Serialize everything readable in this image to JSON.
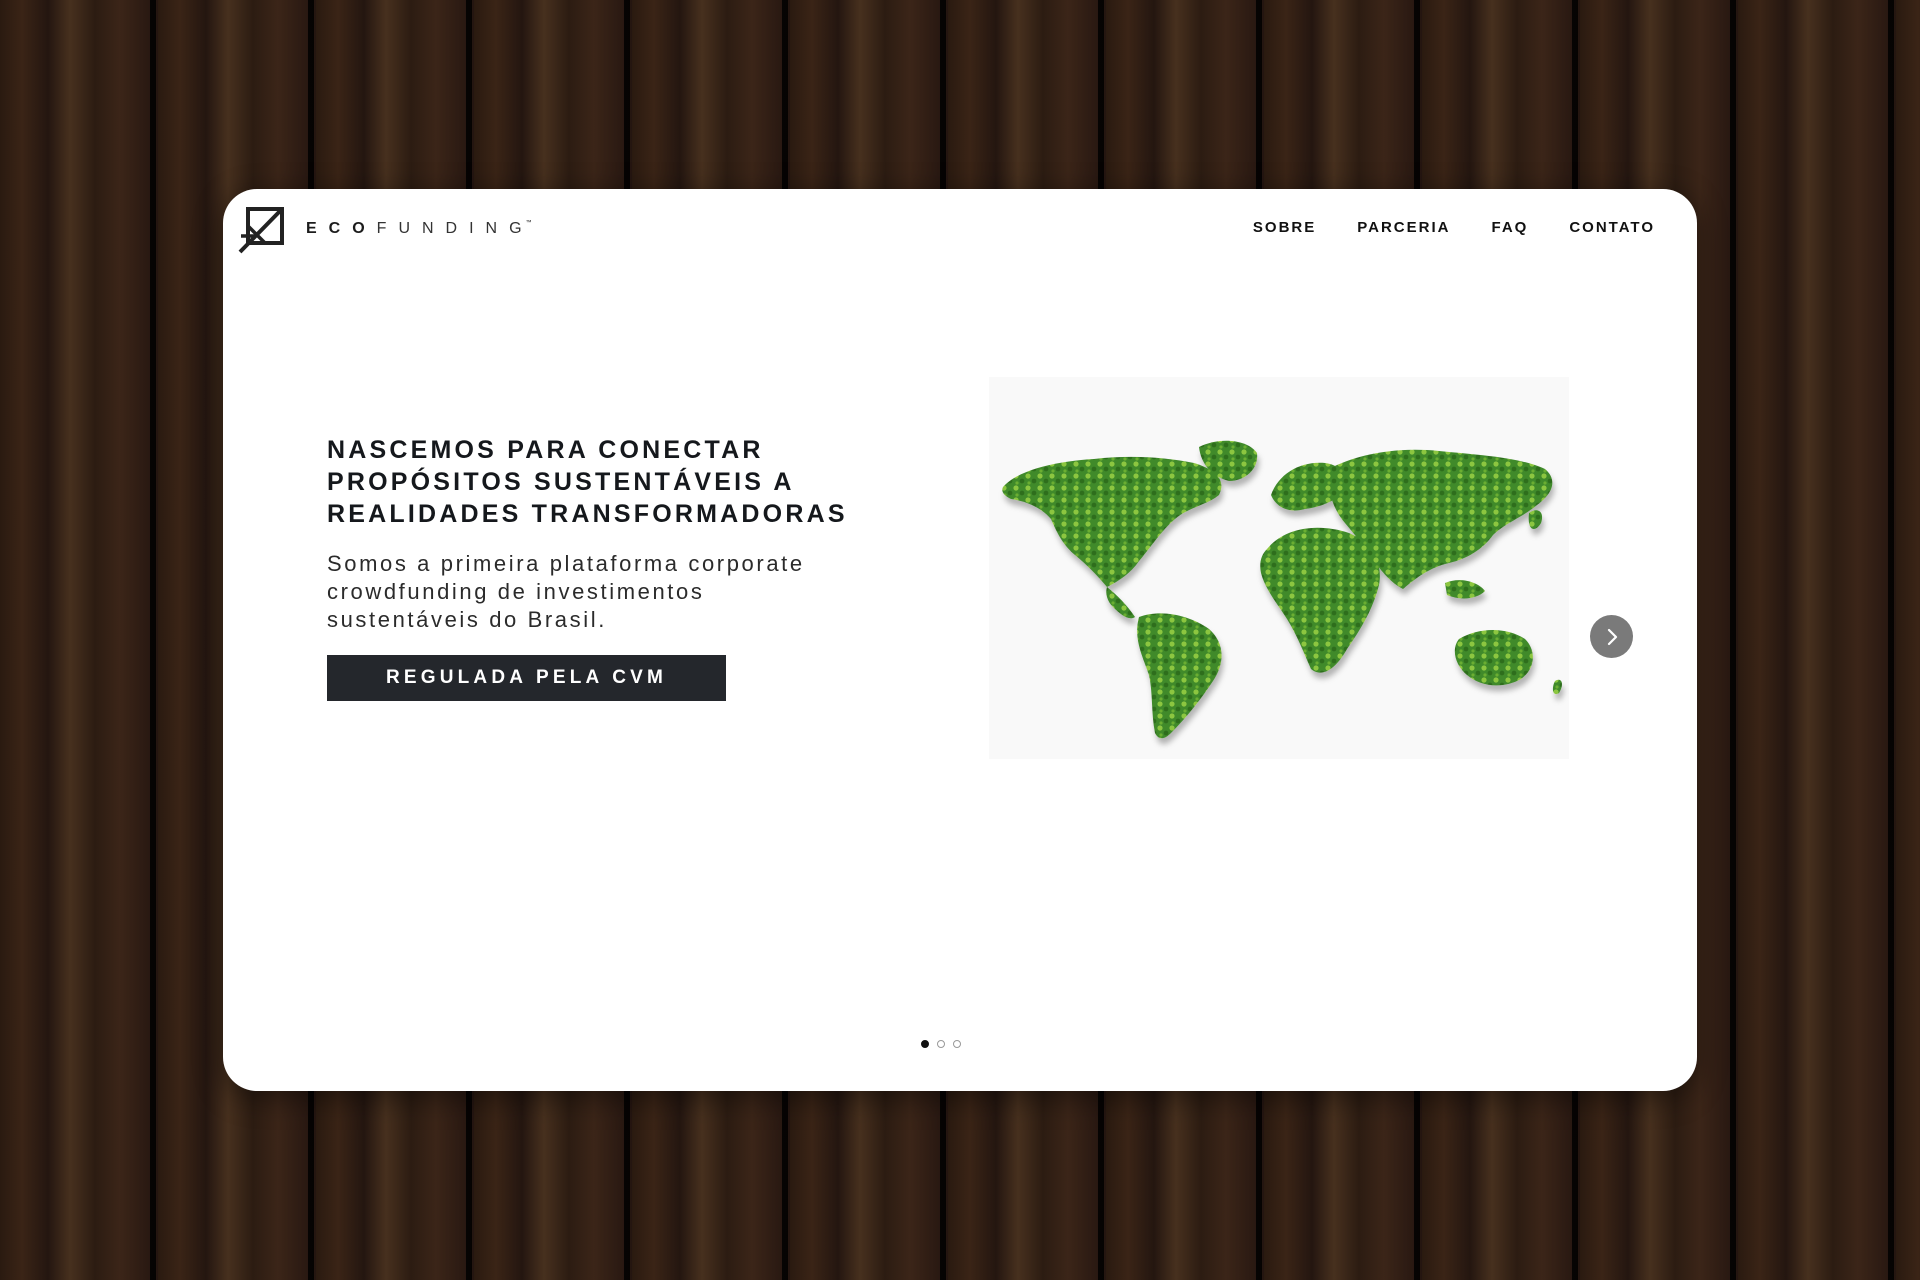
{
  "brand": {
    "logo_icon": "ecofunding-logo-icon",
    "name_bold": "ECO",
    "name_light": "FUNDING",
    "trademark": "™"
  },
  "nav": {
    "items": [
      {
        "label": "SOBRE"
      },
      {
        "label": "PARCERIA"
      },
      {
        "label": "FAQ"
      },
      {
        "label": "CONTATO"
      }
    ]
  },
  "hero": {
    "headline_lines": [
      "NASCEMOS PARA CONECTAR",
      "PROPÓSITOS SUSTENTÁVEIS A",
      "REALIDADES TRANSFORMADORAS"
    ],
    "subtitle_lines": [
      "Somos a primeira plataforma corporate",
      "crowdfunding de investimentos",
      "sustentáveis do Brasil."
    ],
    "cta_label": "REGULADA PELA CVM",
    "image": "green-world-map-trees"
  },
  "carousel": {
    "next_icon": "chevron-right-icon",
    "total_slides": 3,
    "active_slide": 1
  },
  "colors": {
    "accent_dark": "#24272c",
    "map_green": "#3f8a2a",
    "map_light_green": "#8cc63f",
    "window_bg": "#ffffff"
  }
}
